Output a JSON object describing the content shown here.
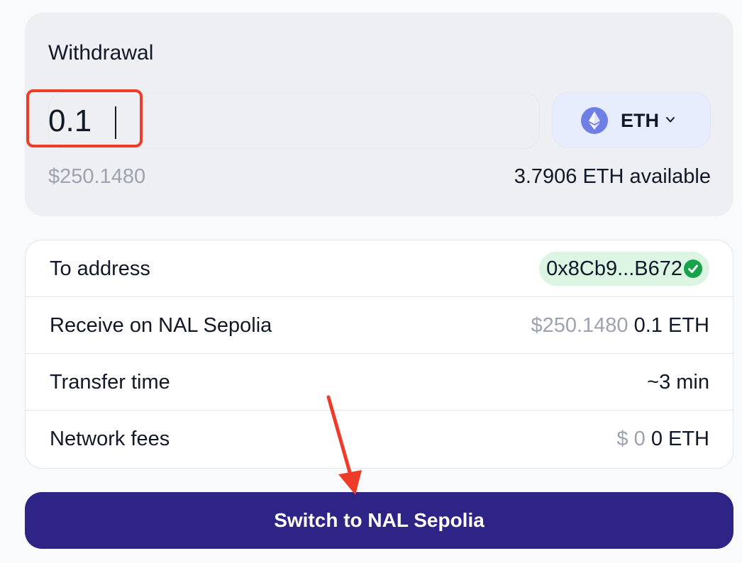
{
  "withdraw": {
    "title": "Withdrawal",
    "amount_value": "0.1",
    "token": {
      "symbol": "ETH",
      "icon": "ethereum-icon"
    },
    "usd_value": "$250.1480",
    "available": "3.7906 ETH available"
  },
  "details": {
    "to_address": {
      "label": "To address",
      "value": "0x8Cb9...B672"
    },
    "receive": {
      "label": "Receive on NAL Sepolia",
      "usd": "$250.1480",
      "amount": "0.1 ETH"
    },
    "transfer_time": {
      "label": "Transfer time",
      "value": "~3 min"
    },
    "network_fees": {
      "label": "Network fees",
      "usd": "$ 0",
      "amount": "0 ETH"
    }
  },
  "action": {
    "label": "Switch to NAL Sepolia"
  },
  "colors": {
    "primary_button": "#2e2485",
    "annotation": "#ef3b2a",
    "success": "#16a34a",
    "token_bg": "#e8edfd"
  }
}
